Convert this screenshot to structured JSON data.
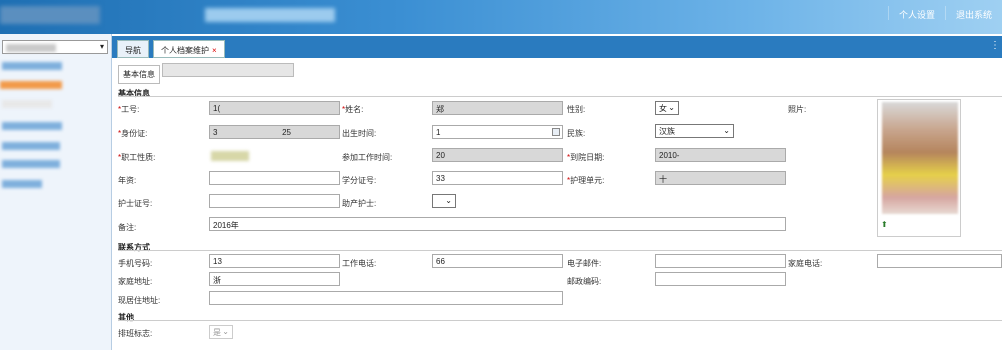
{
  "header": {
    "nav": [
      "个人设置",
      "退出系统"
    ]
  },
  "tabs": {
    "nav_label": "导航",
    "active_label": "个人档案维护",
    "close": "×"
  },
  "subtab": {
    "label": "基本信息"
  },
  "sections": {
    "basic": "基本信息",
    "contact": "联系方式",
    "other": "其他"
  },
  "fields": {
    "emp_id": {
      "label": "工号:",
      "value": "1("
    },
    "name": {
      "label": "姓名:",
      "value": "郑"
    },
    "gender": {
      "label": "性别:",
      "value": "女"
    },
    "photo": {
      "label": "照片:"
    },
    "id_card": {
      "label": "身份证:",
      "value": "3",
      "tail": "25"
    },
    "birth": {
      "label": "出生时间:",
      "value": "1"
    },
    "ethnic": {
      "label": "民族:",
      "value": "汉族"
    },
    "work_type": {
      "label": "职工性质:"
    },
    "start_work": {
      "label": "参加工作时间:",
      "value": "20"
    },
    "hire_date": {
      "label": "到院日期:",
      "value": "2010-"
    },
    "grade": {
      "label": "年资:"
    },
    "license": {
      "label": "学分证号:",
      "value": "33"
    },
    "unit": {
      "label": "护理单元:",
      "value": "十"
    },
    "nurse_no": {
      "label": "护士证号:"
    },
    "maternity": {
      "label": "助产护士:"
    },
    "remark": {
      "label": "备注:",
      "value": "2016年"
    },
    "mobile": {
      "label": "手机号码:",
      "value": "13"
    },
    "work_phone": {
      "label": "工作电话:",
      "value": "66"
    },
    "email": {
      "label": "电子邮件:"
    },
    "home_phone": {
      "label": "家庭电话:"
    },
    "address": {
      "label": "家庭地址:",
      "value": "浙"
    },
    "zip": {
      "label": "邮政编码:"
    },
    "current_addr": {
      "label": "现居住地址:"
    },
    "schedule": {
      "label": "排班标志:",
      "value": "是"
    }
  }
}
